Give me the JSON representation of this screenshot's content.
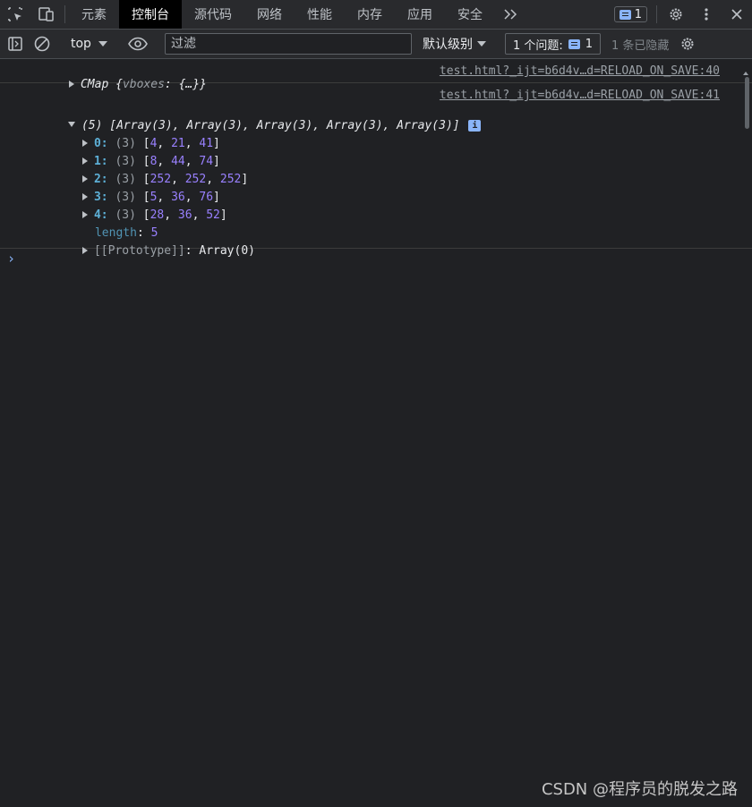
{
  "tabs": [
    {
      "label": "元素",
      "active": false
    },
    {
      "label": "控制台",
      "active": true
    },
    {
      "label": "源代码",
      "active": false
    },
    {
      "label": "网络",
      "active": false
    },
    {
      "label": "性能",
      "active": false
    },
    {
      "label": "内存",
      "active": false
    },
    {
      "label": "应用",
      "active": false
    },
    {
      "label": "安全",
      "active": false
    }
  ],
  "tabbar": {
    "message_count": "1"
  },
  "toolbar": {
    "context": "top",
    "filter_placeholder": "过滤",
    "levels": "默认级别",
    "issues_label": "1 个问题:",
    "issues_count": "1",
    "hidden": "1 条已隐藏"
  },
  "console": {
    "msg1": {
      "source": "test.html?_ijt=b6d4v…d=RELOAD_ON_SAVE:40",
      "name": "CMap",
      "open": "{",
      "prop": "vboxes",
      "colon": ":",
      "val": "{…}",
      "close": "}"
    },
    "msg2": {
      "source": "test.html?_ijt=b6d4v…d=RELOAD_ON_SAVE:41",
      "summary": "(5) [Array(3), Array(3), Array(3), Array(3), Array(3)]",
      "info": "i",
      "items": [
        {
          "key": "0",
          "count": "(3)",
          "values": [
            "4",
            "21",
            "41"
          ]
        },
        {
          "key": "1",
          "count": "(3)",
          "values": [
            "8",
            "44",
            "74"
          ]
        },
        {
          "key": "2",
          "count": "(3)",
          "values": [
            "252",
            "252",
            "252"
          ]
        },
        {
          "key": "3",
          "count": "(3)",
          "values": [
            "5",
            "36",
            "76"
          ]
        },
        {
          "key": "4",
          "count": "(3)",
          "values": [
            "28",
            "36",
            "52"
          ]
        }
      ],
      "length_key": "length",
      "length_value": "5",
      "prototype_key": "[[Prototype]]",
      "prototype_value": "Array(0)"
    },
    "prompt": "›"
  },
  "watermark": "CSDN @程序员的脱发之路",
  "colors": {
    "background": "#202124",
    "accent": "#8ab4f8",
    "number": "#9980ff",
    "key": "#5db0d7"
  }
}
